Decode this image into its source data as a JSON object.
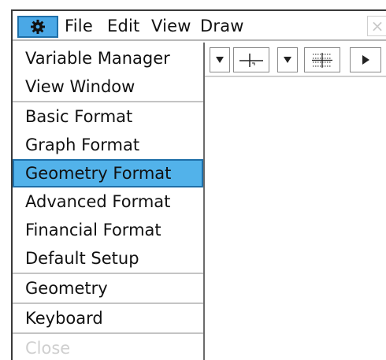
{
  "menubar": {
    "settings_icon": "gear-icon",
    "menus": [
      "File",
      "Edit",
      "View",
      "Draw"
    ],
    "close_symbol": "×"
  },
  "toolbar": {
    "icons": [
      "dropdown-arrow-icon",
      "axes-icon",
      "dropdown-arrow-icon",
      "grid-icon",
      "play-arrow-icon"
    ]
  },
  "dropdown": {
    "items": [
      {
        "label": "Variable Manager",
        "state": "normal"
      },
      {
        "label": "View Window",
        "state": "normal"
      },
      {
        "label": "Basic Format",
        "state": "normal"
      },
      {
        "label": "Graph Format",
        "state": "normal"
      },
      {
        "label": "Geometry Format",
        "state": "selected"
      },
      {
        "label": "Advanced Format",
        "state": "normal"
      },
      {
        "label": "Financial Format",
        "state": "normal"
      },
      {
        "label": "Default Setup",
        "state": "normal"
      },
      {
        "label": "Geometry",
        "state": "normal"
      },
      {
        "label": "Keyboard",
        "state": "normal"
      },
      {
        "label": "Close",
        "state": "disabled"
      }
    ]
  },
  "colors": {
    "selection": "#52b2ea",
    "selection_border": "#1f6fa8",
    "disabled_text": "#cfcfcf"
  }
}
